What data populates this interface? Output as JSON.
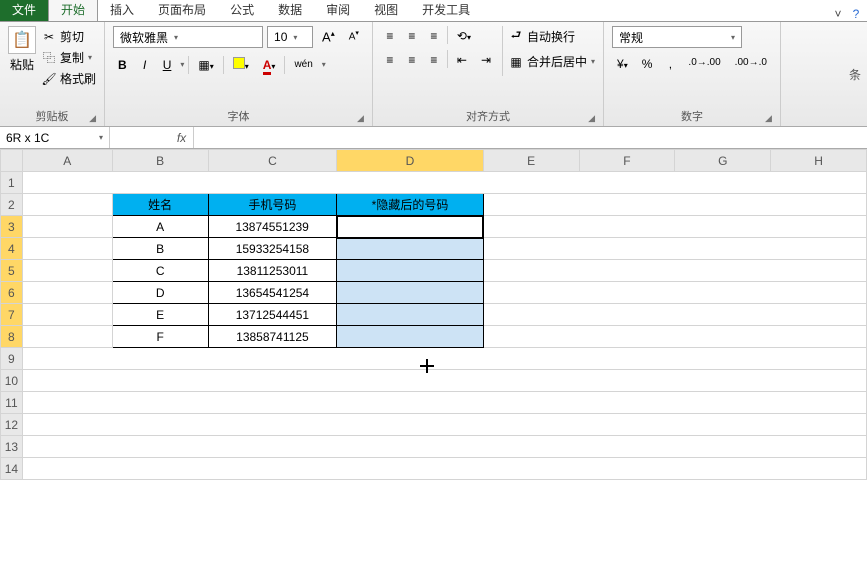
{
  "tabs": {
    "file": "文件",
    "items": [
      "开始",
      "插入",
      "页面布局",
      "公式",
      "数据",
      "审阅",
      "视图",
      "开发工具"
    ],
    "active_index": 0
  },
  "ribbon": {
    "clipboard": {
      "label": "剪贴板",
      "paste": "粘贴",
      "cut": "剪切",
      "copy": "复制",
      "format_painter": "格式刷"
    },
    "font": {
      "label": "字体",
      "family": "微软雅黑",
      "size": "10",
      "bold": "B",
      "italic": "I",
      "underline": "U",
      "phonetic": "wén"
    },
    "alignment": {
      "label": "对齐方式",
      "wrap": "自动换行",
      "merge": "合并后居中"
    },
    "number": {
      "label": "数字",
      "format": "常规"
    },
    "conditional_hint": "条"
  },
  "formula_bar": {
    "name_box": "6R x 1C",
    "fx": "fx",
    "formula": ""
  },
  "grid": {
    "cols": [
      "A",
      "B",
      "C",
      "D",
      "E",
      "F",
      "G",
      "H"
    ],
    "selected_col": "D",
    "selected_rows": [
      3,
      4,
      5,
      6,
      7,
      8
    ],
    "row_count": 14
  },
  "table": {
    "header": {
      "name": "姓名",
      "phone": "手机号码",
      "masked": "*隐藏后的号码"
    },
    "rows": [
      {
        "name": "A",
        "phone": "13874551239",
        "masked": ""
      },
      {
        "name": "B",
        "phone": "15933254158",
        "masked": ""
      },
      {
        "name": "C",
        "phone": "13811253011",
        "masked": ""
      },
      {
        "name": "D",
        "phone": "13654541254",
        "masked": ""
      },
      {
        "name": "E",
        "phone": "13712544451",
        "masked": ""
      },
      {
        "name": "F",
        "phone": "13858741125",
        "masked": ""
      }
    ]
  }
}
